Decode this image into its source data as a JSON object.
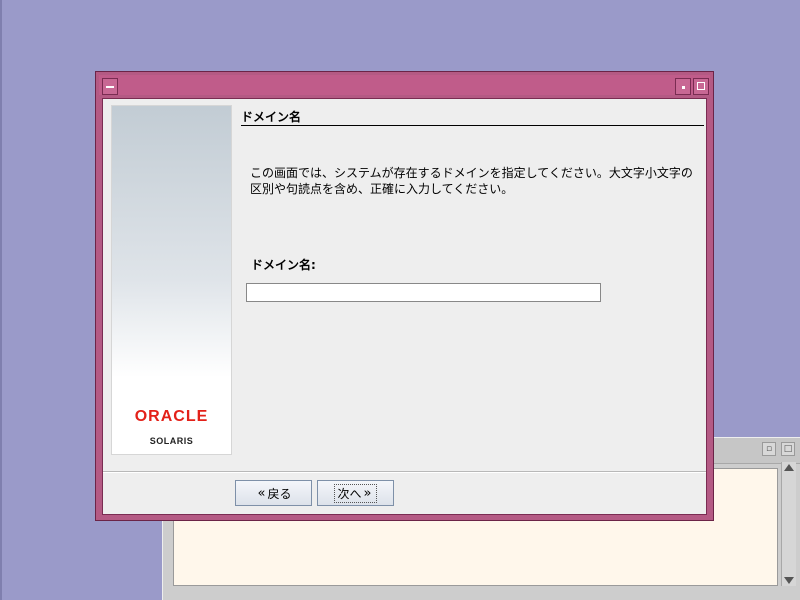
{
  "dialog": {
    "heading": "ドメイン名",
    "description": "この画面では、システムが存在するドメインを指定してください。大文字小文字の区別や句読点を含め、正確に入力してください。",
    "field_label": "ドメイン名:",
    "field_value": "",
    "buttons": {
      "back_label": "戻る",
      "next_label": "次へ"
    }
  },
  "branding": {
    "logo_text": "ORACLE",
    "product": "SOLARIS",
    "logo_color": "#e32119"
  },
  "colors": {
    "desktop": "#9a9ac9",
    "titlebar": "#b45a84",
    "background_window_content": "#fff7eb"
  }
}
